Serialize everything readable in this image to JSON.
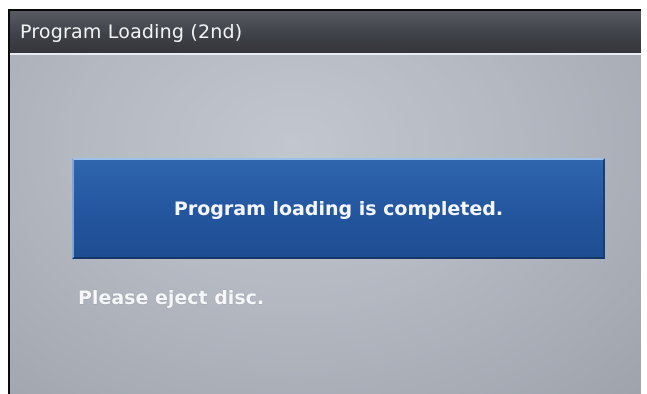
{
  "header": {
    "title": "Program Loading (2nd)"
  },
  "dialog": {
    "message": "Program loading is completed.",
    "instruction": "Please eject disc."
  },
  "colors": {
    "title_bar": "#3f4248",
    "background": "#b4b8c1",
    "message_box": "#2457a0",
    "text": "#f4f6fa"
  }
}
